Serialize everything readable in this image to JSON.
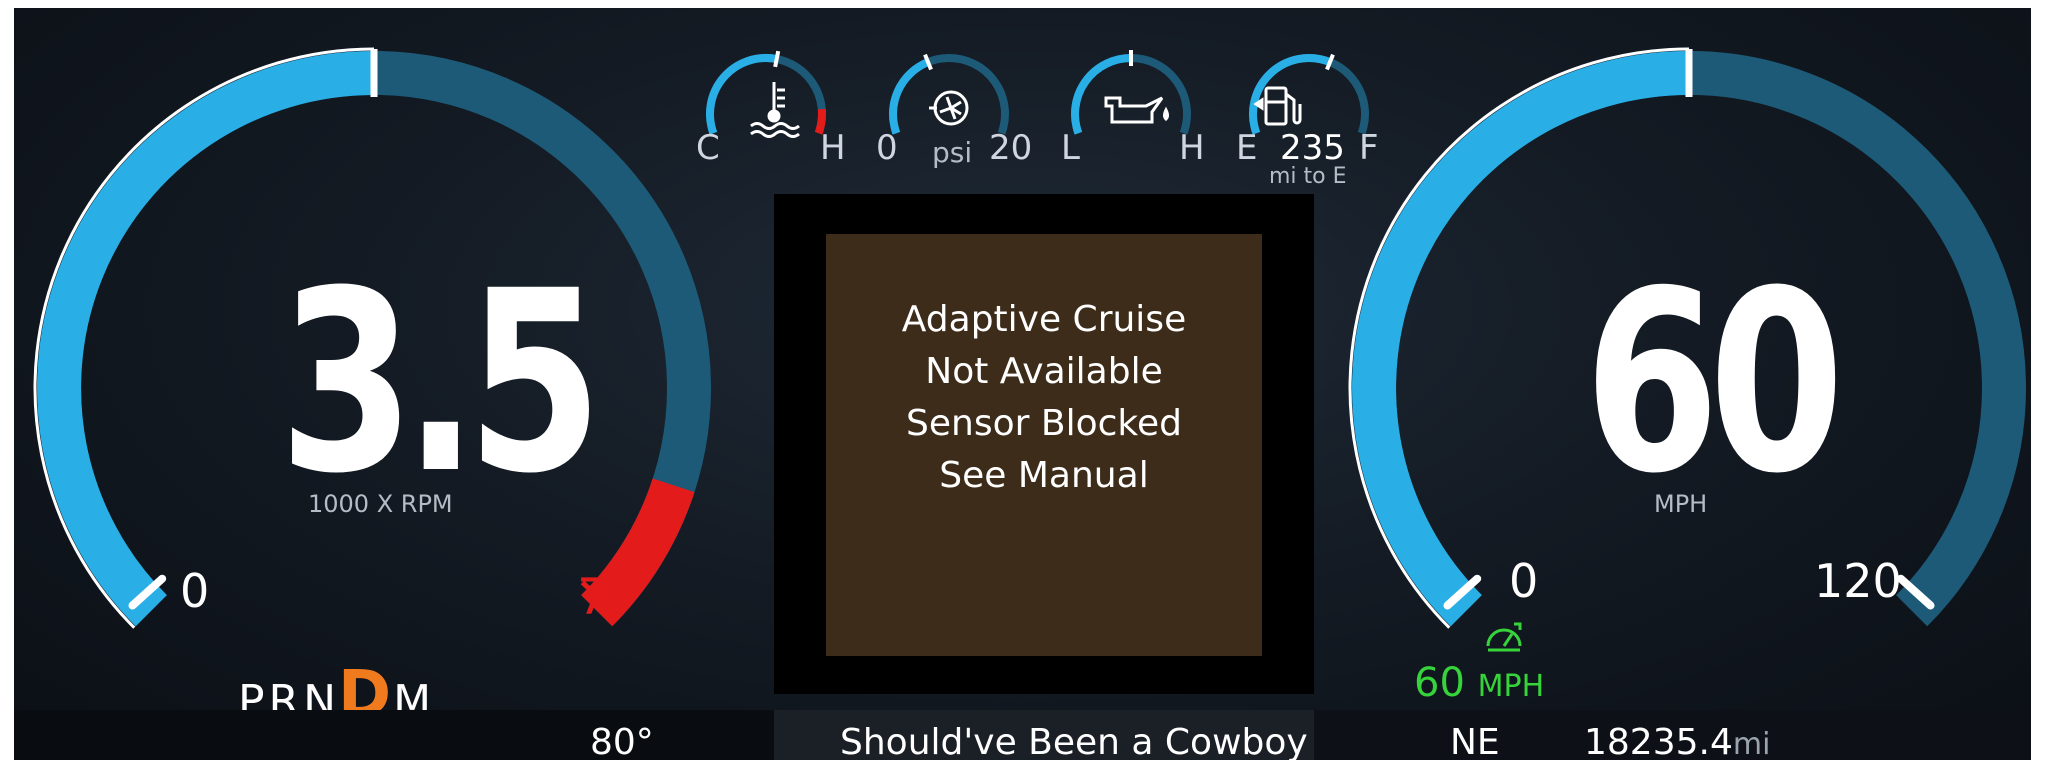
{
  "tachometer": {
    "value": "3.5",
    "unit": "1000 X RPM",
    "min_label": "0",
    "redline_label": "7"
  },
  "speedometer": {
    "value": "60",
    "unit": "MPH",
    "min_label": "0",
    "max_label": "120"
  },
  "gauges": {
    "coolant": {
      "icon": "coolant-temp-icon",
      "low": "C",
      "high": "H"
    },
    "turbo": {
      "icon": "turbo-boost-icon",
      "low": "0",
      "unit": "psi",
      "high": "20"
    },
    "oil": {
      "icon": "oil-pressure-icon",
      "low": "L",
      "high": "H"
    },
    "fuel": {
      "icon": "fuel-pump-icon",
      "low": "E",
      "range": "235",
      "range_unit": "mi to E",
      "high": "F"
    }
  },
  "transmission": {
    "p": "P",
    "r": "R",
    "n": "N",
    "d": "D",
    "m": "M",
    "selected": "D"
  },
  "cruise": {
    "icon": "cruise-speedometer-icon",
    "set_speed": "60",
    "unit": "MPH"
  },
  "message": {
    "line1": "Adaptive Cruise",
    "line2": "Not Available",
    "line3": "Sensor Blocked",
    "line4": "See Manual"
  },
  "status_bar": {
    "outside_temp": "80°",
    "song_icon": "music-note-icon",
    "song_title": "Should've Been a Cowboy",
    "compass": "NE",
    "odometer": "18235.4",
    "odometer_unit": "mi"
  },
  "colors": {
    "gauge_fill": "#2aaee6",
    "gauge_track": "#1d5a78",
    "redline": "#e41b1b",
    "warning_frame": "#f5a21b",
    "message_bg": "#3d2c19",
    "cruise_green": "#36d43a",
    "gear_active": "#f07a1e"
  },
  "levels": {
    "tach_fraction": 0.5,
    "speed_fraction": 0.5,
    "coolant_fraction": 0.55,
    "turbo_fraction": 0.4,
    "oil_fraction": 0.5,
    "fuel_fraction": 0.6
  }
}
